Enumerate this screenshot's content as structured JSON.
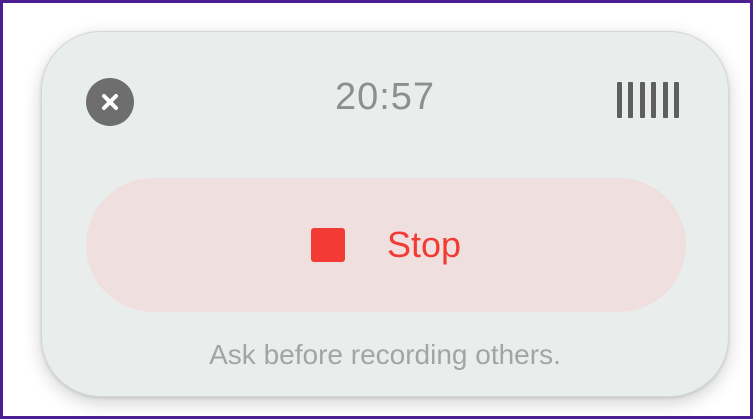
{
  "recorder": {
    "timer": "20:57",
    "stop_label": "Stop",
    "hint": "Ask before recording others.",
    "close_icon": "close-icon",
    "levels_icon": "audio-levels-icon",
    "stop_icon": "stop-square-icon"
  },
  "colors": {
    "accent": "#f23b34",
    "panel": "#e9eeec",
    "stop_background": "#efe0df",
    "border": "#4b1e91"
  }
}
